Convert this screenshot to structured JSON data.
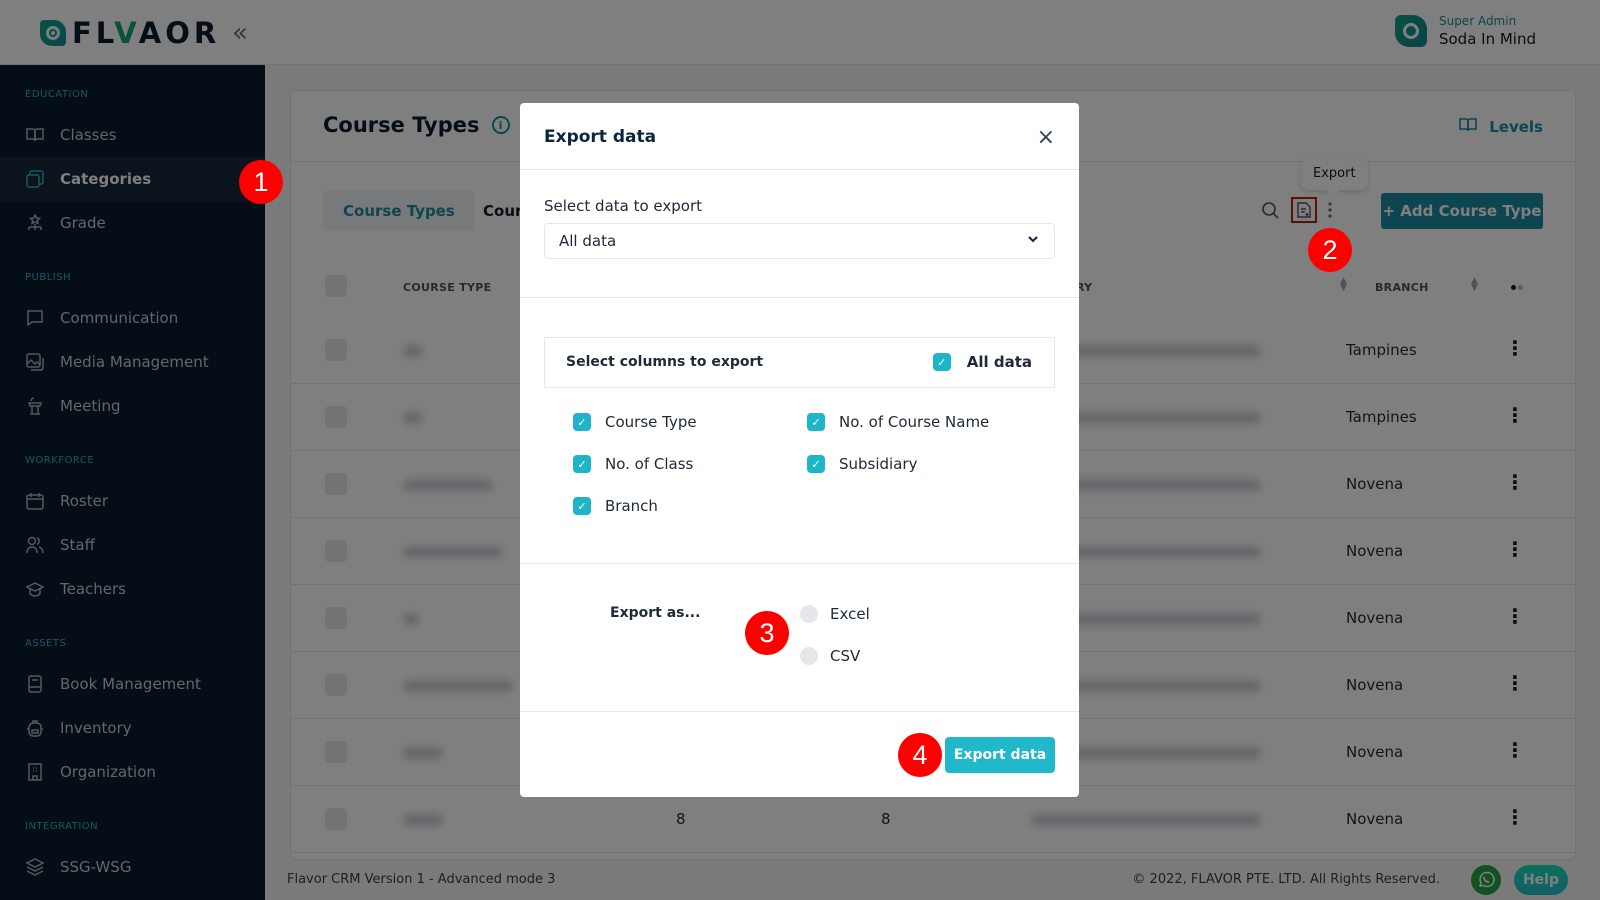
{
  "header": {
    "logo_text_prefix": "FL",
    "logo_text_v": "V",
    "logo_text_a": "A",
    "logo_text_suffix": "OR",
    "collapse_icon": "«",
    "user_role": "Super Admin",
    "user_name": "Soda In Mind"
  },
  "sidebar": {
    "sections": [
      {
        "title": "EDUCATION",
        "items": [
          {
            "label": "Classes",
            "icon": "book-open-icon"
          },
          {
            "label": "Categories",
            "icon": "categories-icon",
            "active": true
          },
          {
            "label": "Grade",
            "icon": "hierarchy-icon"
          }
        ]
      },
      {
        "title": "PUBLISH",
        "items": [
          {
            "label": "Communication",
            "icon": "chat-icon"
          },
          {
            "label": "Media Management",
            "icon": "image-icon"
          },
          {
            "label": "Meeting",
            "icon": "podium-icon"
          }
        ]
      },
      {
        "title": "WORKFORCE",
        "items": [
          {
            "label": "Roster",
            "icon": "calendar-icon"
          },
          {
            "label": "Staff",
            "icon": "users-icon"
          },
          {
            "label": "Teachers",
            "icon": "graduation-cap-icon"
          }
        ]
      },
      {
        "title": "ASSETS",
        "items": [
          {
            "label": "Book Management",
            "icon": "book-icon"
          },
          {
            "label": "Inventory",
            "icon": "backpack-icon"
          },
          {
            "label": "Organization",
            "icon": "building-icon"
          }
        ]
      },
      {
        "title": "INTEGRATION",
        "items": [
          {
            "label": "SSG-WSG",
            "icon": "layers-icon"
          }
        ]
      }
    ]
  },
  "main": {
    "title": "Course Types",
    "levels_link": "Levels",
    "tabs": [
      {
        "label": "Course Types",
        "active": true
      },
      {
        "label": "Cour"
      }
    ],
    "tooltip": "Export",
    "add_button": "+ Add Course Type",
    "table": {
      "headers": [
        "COURSE TYPE",
        "RY",
        "BRANCH"
      ],
      "rows": [
        {
          "branch": "Tampines"
        },
        {
          "branch": "Tampines"
        },
        {
          "branch": "Novena"
        },
        {
          "branch": "Novena"
        },
        {
          "branch": "Novena"
        },
        {
          "branch": "Novena"
        },
        {
          "branch": "Novena"
        },
        {
          "branch": "Novena",
          "col2": "8",
          "col3": "8"
        }
      ]
    }
  },
  "footer": {
    "version": "Flavor CRM Version 1 - Advanced mode 3",
    "copyright": "© 2022, FLAVOR PTE. LTD. All Rights Reserved.",
    "help": "Help"
  },
  "modal": {
    "title": "Export data",
    "close": "×",
    "select_label": "Select data to export",
    "select_value": "All data",
    "columns_title": "Select columns to export",
    "columns_all_label": "All data",
    "columns_all_checked": true,
    "columns": [
      {
        "label": "Course Type",
        "checked": true
      },
      {
        "label": "No. of Course Name",
        "checked": true
      },
      {
        "label": "No. of Class",
        "checked": true
      },
      {
        "label": "Subsidiary",
        "checked": true
      },
      {
        "label": "Branch",
        "checked": true
      }
    ],
    "export_as_label": "Export as...",
    "formats": [
      {
        "label": "Excel",
        "selected": false
      },
      {
        "label": "CSV",
        "selected": false
      }
    ],
    "export_button": "Export data"
  },
  "steps": [
    "1",
    "2",
    "3",
    "4"
  ],
  "colors": {
    "sidebar_bg": "#0a1a2f",
    "accent": "#1a8aa0",
    "checkbox": "#1fb5c9",
    "step_marker": "#ff0000"
  }
}
